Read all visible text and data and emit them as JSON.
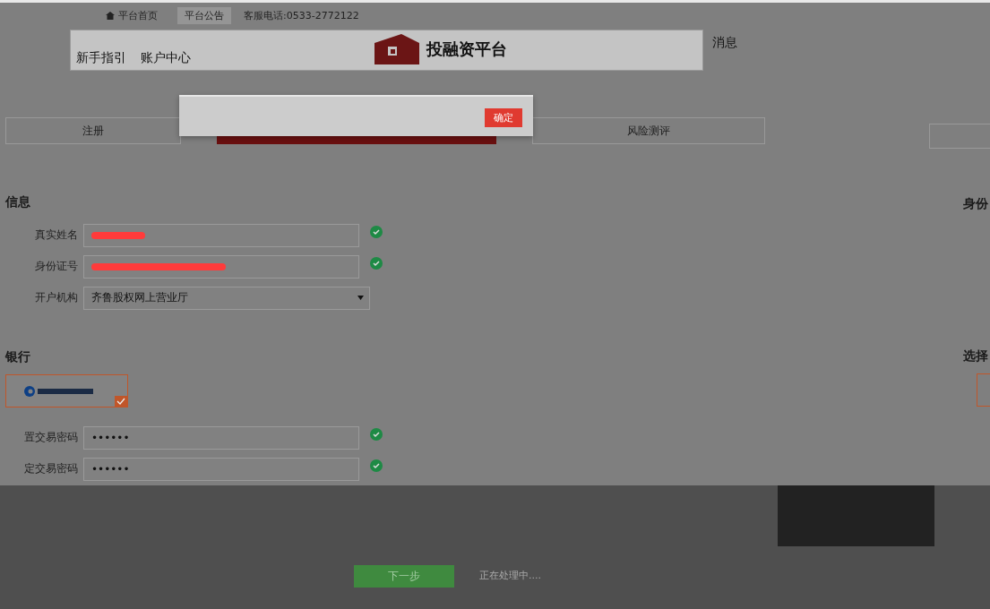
{
  "top_bar": {
    "links": [
      {
        "label": "平台首页",
        "selected": false
      },
      {
        "label": "平台公告",
        "selected": true
      }
    ],
    "phone": "客服电话:0533-2772122"
  },
  "header": {
    "nav": [
      "新手指引",
      "账户中心"
    ],
    "logo_text": "投融资平台",
    "messages": "消息"
  },
  "steps": [
    {
      "label": "注册",
      "selected": false
    },
    {
      "selected": true
    },
    {
      "label": "风险测评",
      "selected": false
    }
  ],
  "identity": {
    "heading": "信息",
    "fields": [
      {
        "kind": "text",
        "label": "真实姓名",
        "redacted": true,
        "valid": true
      },
      {
        "kind": "text",
        "label": "身份证号",
        "redacted": true,
        "valid": true
      },
      {
        "kind": "select",
        "label": "开户机构",
        "value": "齐鲁股权网上营业厅"
      }
    ]
  },
  "bank": {
    "heading": "银行",
    "card_selected": true,
    "fields": [
      {
        "kind": "password",
        "label": "置交易密码",
        "value": "••••••",
        "valid": true
      },
      {
        "kind": "password",
        "label": "定交易密码",
        "value": "••••••",
        "valid": true
      }
    ]
  },
  "right_column": {
    "headings": [
      "身份",
      "选择"
    ]
  },
  "footer": {
    "next_button": "下一步",
    "status": "正在处理中...."
  },
  "dialog": {
    "confirm_button": "确定"
  }
}
